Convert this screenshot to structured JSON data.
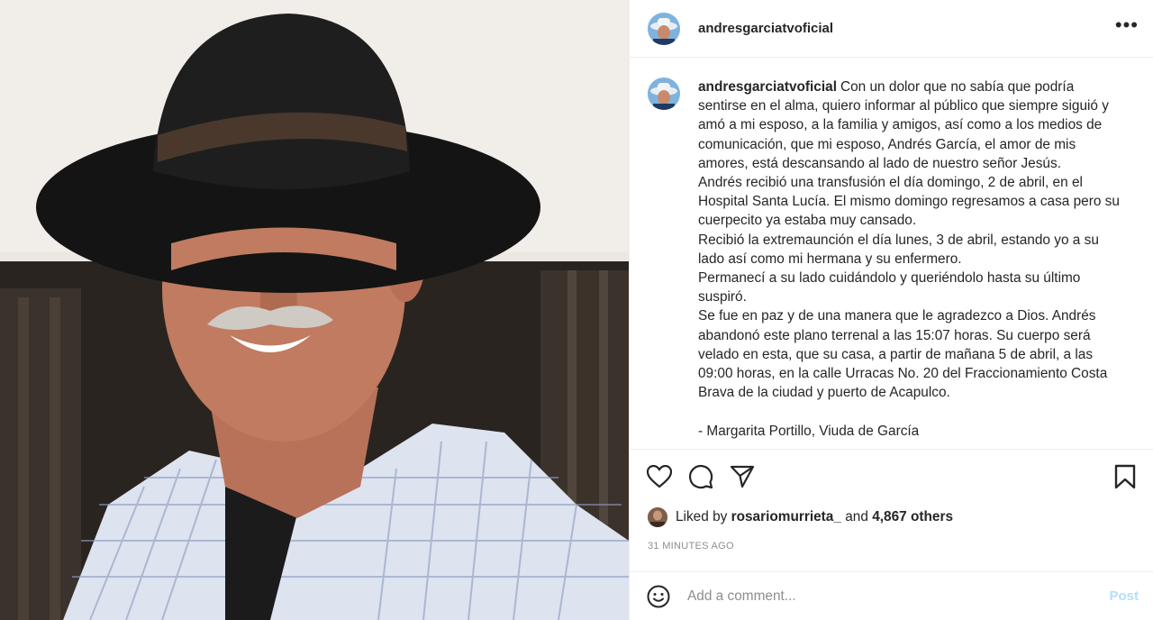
{
  "post": {
    "username": "andresgarciatvoficial",
    "more_label": "•••",
    "caption": {
      "username": "andresgarciatvoficial",
      "text": "Con un dolor que no sabía que podría sentirse en el alma, quiero informar al público que siempre siguió y amó a mi esposo, a la familia y amigos, así como a los medios de comunicación, que mi esposo, Andrés García, el amor de mis amores, está descansando al lado de nuestro señor Jesús.\nAndrés recibió una transfusión el día domingo, 2 de abril, en el Hospital Santa Lucía. El mismo domingo regresamos a casa pero su cuerpecito ya estaba muy cansado.\nRecibió la extremaunción el día lunes, 3 de abril, estando yo a su lado así como mi hermana y su enfermero.\nPermanecí a su lado cuidándolo y queriéndolo hasta su último suspiró.\nSe fue en paz y de una manera que le agradezco a Dios. Andrés abandonó este plano terrenal a las 15:07 horas. Su cuerpo será velado en esta, que su casa, a partir de mañana 5 de abril, a las 09:00 horas, en la calle Urracas No. 20 del Fraccionamiento Costa Brava de la ciudad y puerto de Acapulco.\n\n- Margarita Portillo, Viuda de García"
    },
    "actions": {
      "like_icon": "heart-outline-icon",
      "comment_icon": "comment-bubble-icon",
      "share_icon": "paper-plane-icon",
      "save_icon": "bookmark-icon"
    },
    "likes": {
      "prefix": "Liked by",
      "liker": "rosariomurrieta_",
      "connector": "and",
      "others": "4,867 others"
    },
    "timestamp": "31 MINUTES AGO",
    "comment_box": {
      "placeholder": "Add a comment...",
      "post_label": "Post",
      "emoji_icon": "smiley-icon"
    },
    "colors": {
      "text": "#262626",
      "muted": "#8e8e8e",
      "post_button_disabled": "#b2dffc",
      "border": "#efefef"
    }
  }
}
